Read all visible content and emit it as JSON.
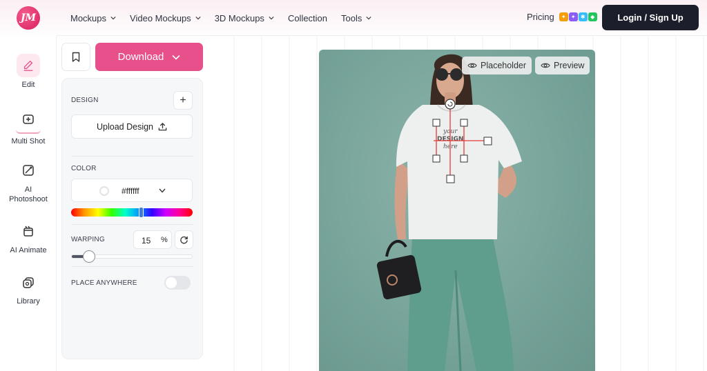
{
  "brand": {
    "logo_text": "JM"
  },
  "nav": {
    "items": [
      {
        "label": "Mockups",
        "has_dropdown": true
      },
      {
        "label": "Video Mockups",
        "has_dropdown": true
      },
      {
        "label": "3D Mockups",
        "has_dropdown": true
      },
      {
        "label": "Collection",
        "has_dropdown": false
      },
      {
        "label": "Tools",
        "has_dropdown": true
      }
    ],
    "pricing_label": "Pricing",
    "login_label": "Login / Sign Up"
  },
  "rail": {
    "items": [
      {
        "label": "Edit",
        "icon": "pencil-icon",
        "active": true
      },
      {
        "label": "Multi Shot",
        "icon": "multi-shot-icon",
        "active": false
      },
      {
        "label": "AI Photoshoot",
        "icon": "ai-photoshoot-icon",
        "active": false
      },
      {
        "label": "AI Animate",
        "icon": "ai-animate-icon",
        "active": false
      },
      {
        "label": "Library",
        "icon": "library-icon",
        "active": false
      }
    ]
  },
  "toolbar": {
    "download_label": "Download"
  },
  "panel": {
    "design_label": "DESIGN",
    "add_label": "+",
    "upload_label": "Upload Design",
    "color_label": "COLOR",
    "color_value": "#ffffff",
    "warping_label": "WARPING",
    "warping_value": "15",
    "warping_unit": "%",
    "warping_fraction": 0.15,
    "place_anywhere_label": "PLACE ANYWHERE",
    "place_anywhere_on": false
  },
  "canvas": {
    "placeholder_label": "Placeholder",
    "preview_label": "Preview",
    "design_text": [
      "your",
      "DESIGN",
      "here"
    ]
  },
  "colors": {
    "accent": "#e8508b",
    "dark": "#1c1f2b",
    "backdrop": "#76a399",
    "pants": "#5f9e8c",
    "handle_line": "#e53935"
  }
}
